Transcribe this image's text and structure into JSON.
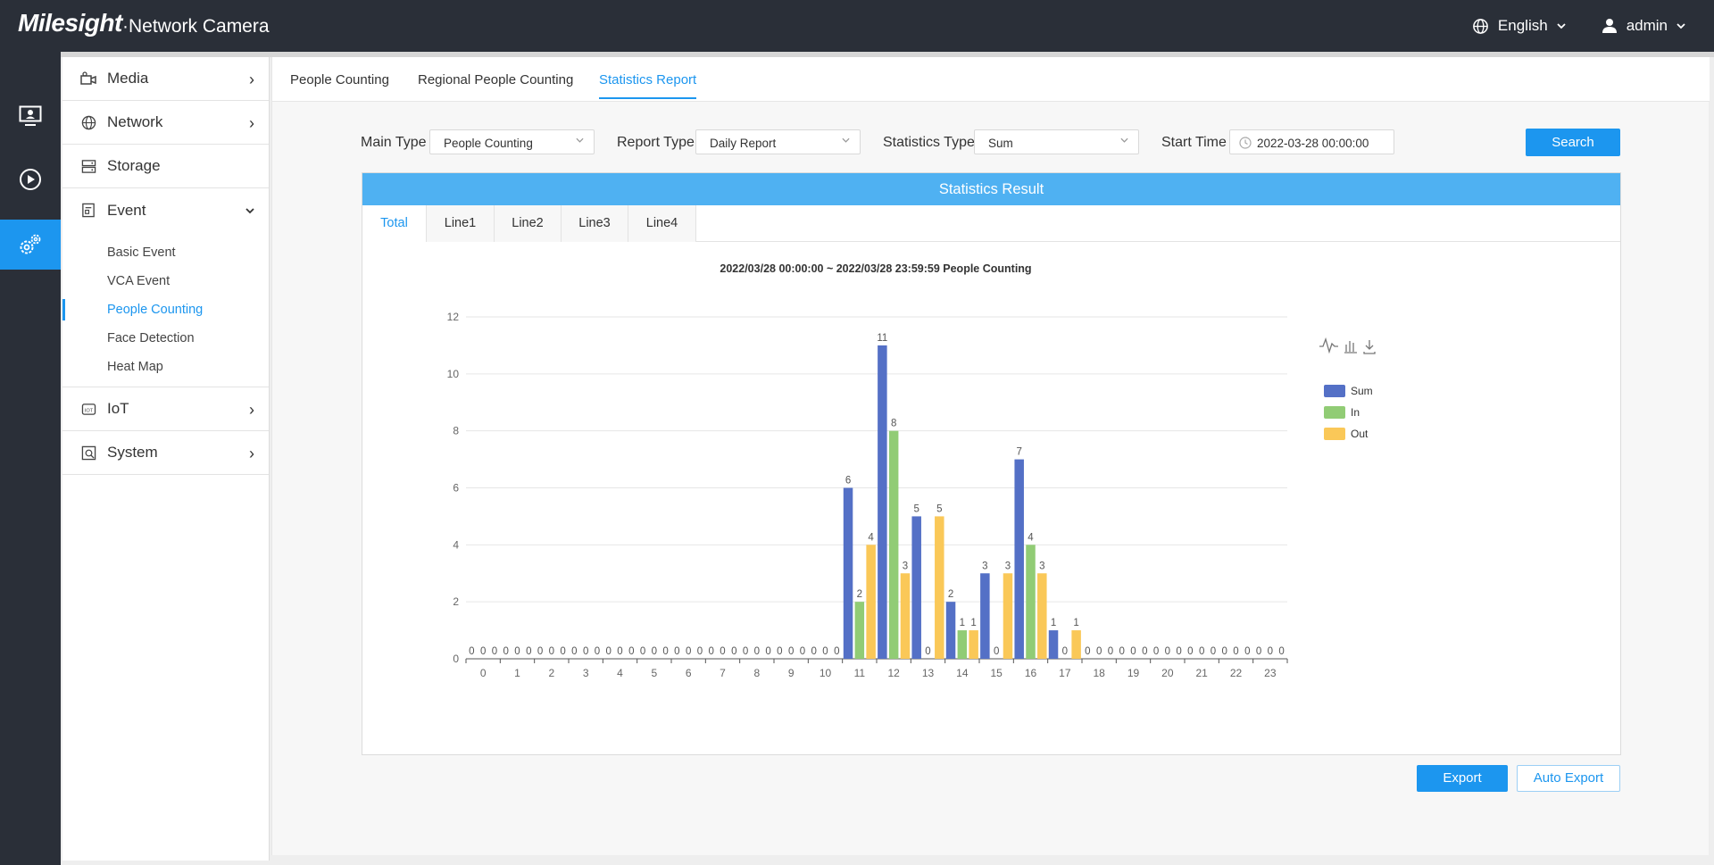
{
  "app": {
    "brand": "Milesight",
    "product": "·Network Camera"
  },
  "topbar": {
    "language": "English",
    "user": "admin"
  },
  "sidebar": {
    "items": [
      {
        "label": "Media",
        "icon": "camera-icon"
      },
      {
        "label": "Network",
        "icon": "globe-icon"
      },
      {
        "label": "Storage",
        "icon": "storage-icon"
      },
      {
        "label": "Event",
        "icon": "event-icon"
      },
      {
        "label": "IoT",
        "icon": "iot-icon"
      },
      {
        "label": "System",
        "icon": "system-icon"
      }
    ],
    "event_sub": [
      "Basic Event",
      "VCA Event",
      "People Counting",
      "Face Detection",
      "Heat Map"
    ]
  },
  "tabs": [
    "People Counting",
    "Regional People Counting",
    "Statistics Report"
  ],
  "filters": {
    "main_type_label": "Main Type",
    "main_type": "People Counting",
    "report_type_label": "Report Type",
    "report_type": "Daily Report",
    "statistics_type_label": "Statistics Type",
    "statistics_type": "Sum",
    "start_time_label": "Start Time",
    "start_time": "2022-03-28 00:00:00",
    "search": "Search"
  },
  "result": {
    "header": "Statistics Result",
    "tabs": [
      "Total",
      "Line1",
      "Line2",
      "Line3",
      "Line4"
    ]
  },
  "actions": {
    "export": "Export",
    "auto_export": "Auto Export"
  },
  "colors": {
    "accent": "#1c96ef",
    "sum": "#5470c6",
    "in": "#91cc75",
    "out": "#fac858"
  },
  "chart_data": {
    "type": "bar",
    "title": "2022/03/28 00:00:00  ~  2022/03/28 23:59:59 People Counting",
    "categories": [
      "0",
      "1",
      "2",
      "3",
      "4",
      "5",
      "6",
      "7",
      "8",
      "9",
      "10",
      "11",
      "12",
      "13",
      "14",
      "15",
      "16",
      "17",
      "18",
      "19",
      "20",
      "21",
      "22",
      "23"
    ],
    "series": [
      {
        "name": "Sum",
        "values": [
          0,
          0,
          0,
          0,
          0,
          0,
          0,
          0,
          0,
          0,
          0,
          6,
          11,
          5,
          2,
          3,
          7,
          1,
          0,
          0,
          0,
          0,
          0,
          0
        ]
      },
      {
        "name": "In",
        "values": [
          0,
          0,
          0,
          0,
          0,
          0,
          0,
          0,
          0,
          0,
          0,
          2,
          8,
          0,
          1,
          0,
          4,
          0,
          0,
          0,
          0,
          0,
          0,
          0
        ]
      },
      {
        "name": "Out",
        "values": [
          0,
          0,
          0,
          0,
          0,
          0,
          0,
          0,
          0,
          0,
          0,
          4,
          3,
          5,
          1,
          3,
          3,
          1,
          0,
          0,
          0,
          0,
          0,
          0
        ]
      }
    ],
    "ylim": [
      0,
      12
    ],
    "yticks": [
      0,
      2,
      4,
      6,
      8,
      10,
      12
    ],
    "grid": true,
    "legend_position": "top-right"
  }
}
